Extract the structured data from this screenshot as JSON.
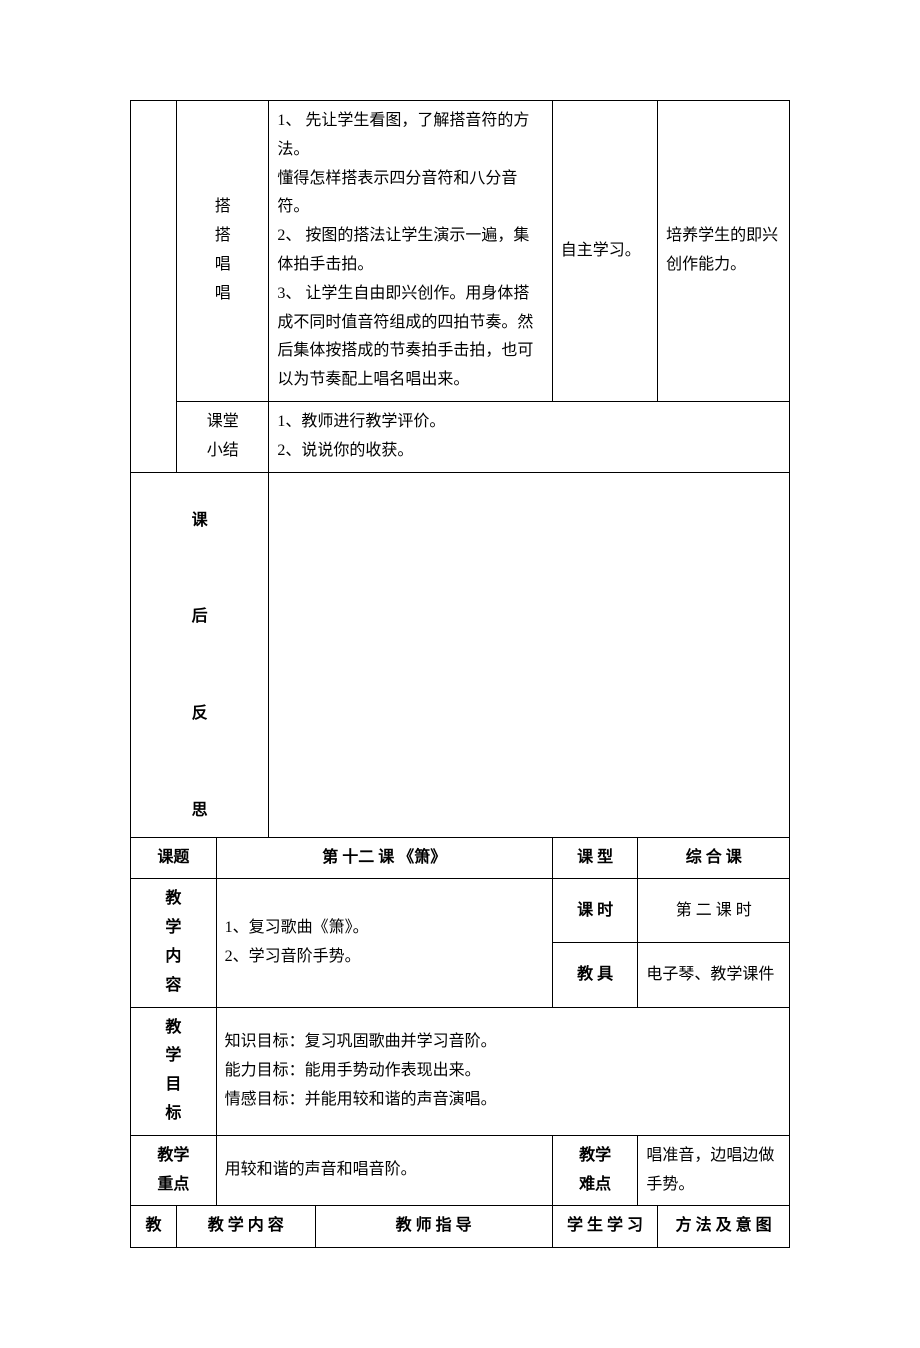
{
  "section1": {
    "row1": {
      "label": "搭搭唱唱",
      "guide": "1、 先让学生看图，了解搭音符的方法。\n懂得怎样搭表示四分音符和八分音符。\n2、 按图的搭法让学生演示一遍，集体拍手击拍。\n3、 让学生自由即兴创作。用身体搭成不同时值音符组成的四拍节奏。然后集体按搭成的节奏拍手击拍，也可以为节奏配上唱名唱出来。",
      "student": "自主学习。",
      "method": "培养学生的即兴创作能力。"
    },
    "row2": {
      "label": "课堂小结",
      "content": "1、教师进行教学评价。\n2、说说你的收获。"
    }
  },
  "reflection": {
    "c1": "课",
    "c2": "后",
    "c3": "反",
    "c4": "思"
  },
  "section2": {
    "topic_label": "课题",
    "topic_value": "第 十二 课  《箫》",
    "type_label": "课 型",
    "type_value": "综   合    课",
    "content_label": "教学内容",
    "content_value": "1、复习歌曲《箫》。\n2、学习音阶手势。",
    "period_label": "课 时",
    "period_value": "第 二 课 时",
    "tools_label": "教 具",
    "tools_value": "电子琴、教学课件",
    "goals_label": "教学目标",
    "goals_value": "知识目标：复习巩固歌曲并学习音阶。\n能力目标：能用手势动作表现出来。\n情感目标：并能用较和谐的声音演唱。",
    "keypoint_label": "教学重点",
    "keypoint_value": "用较和谐的声音和唱音阶。",
    "difficulty_label": "教学难点",
    "difficulty_value": "唱准音，边唱边做手势。",
    "header": {
      "c1": "教",
      "c2": "教 学 内 容",
      "c3": "教 师 指 导",
      "c4": "学 生 学 习",
      "c5": "方 法 及 意 图"
    }
  }
}
